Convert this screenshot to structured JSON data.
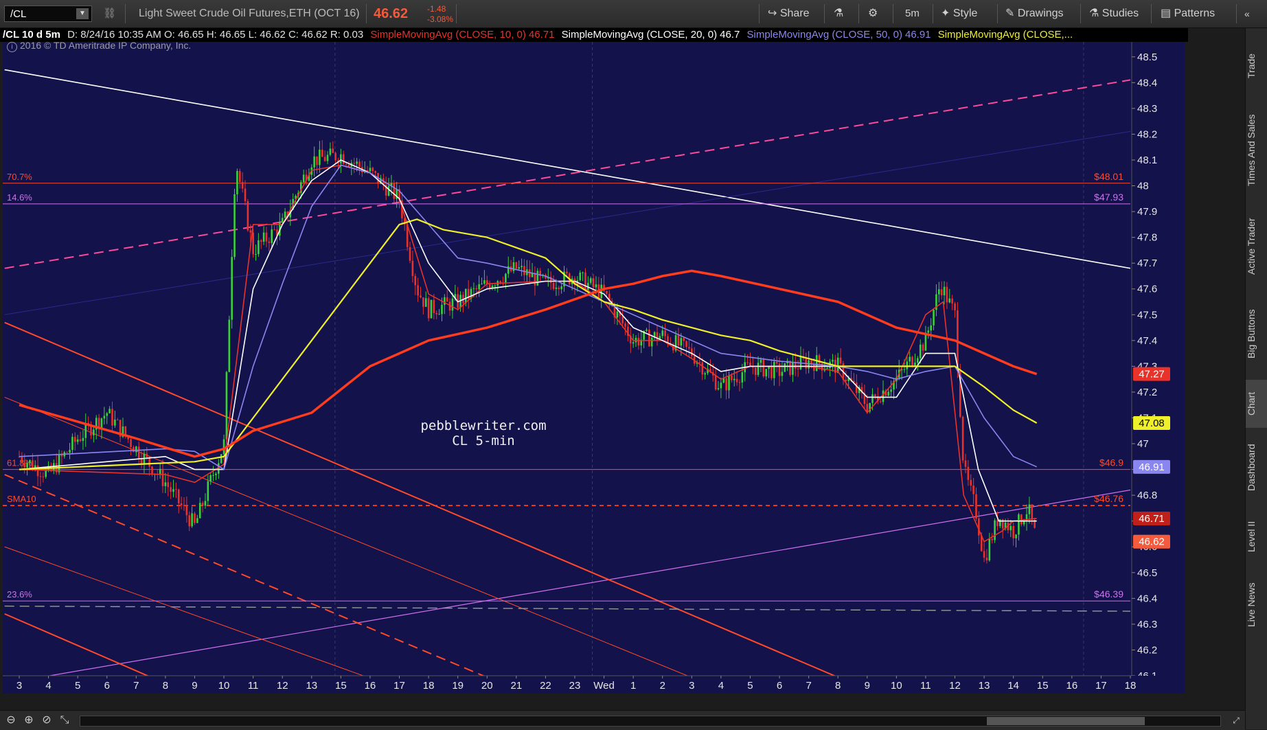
{
  "toolbar": {
    "symbol": "/CL",
    "instrument": "Light Sweet Crude Oil Futures,ETH (OCT 16)",
    "last_price": "46.62",
    "change": "-1.48",
    "change_pct": "-3.08%",
    "share": "Share",
    "timeframe": "5m",
    "style": "Style",
    "drawings": "Drawings",
    "studies": "Studies",
    "patterns": "Patterns"
  },
  "infobar": {
    "desc": "/CL 10 d 5m",
    "ohlc": "D: 8/24/16 10:35 AM  O: 46.65  H: 46.65  L: 46.62  C: 46.62  R: 0.03",
    "sma10": "SimpleMovingAvg (CLOSE, 10, 0)",
    "sma10_val": "46.71",
    "sma20": "SimpleMovingAvg (CLOSE, 20, 0)",
    "sma20_val": "46.7",
    "sma50": "SimpleMovingAvg (CLOSE, 50, 0)",
    "sma50_val": "46.91",
    "sma100": "SimpleMovingAvg (CLOSE,..."
  },
  "copyright": "2016 © TD Ameritrade IP Company, Inc.",
  "watermark": {
    "line1": "pebblewriter.com",
    "line2": "CL 5-min"
  },
  "side_tabs": [
    "Trade",
    "Times And Sales",
    "Active Trader",
    "Big Buttons",
    "Chart",
    "Dashboard",
    "Level II",
    "Live News"
  ],
  "colors": {
    "background": "#14124a",
    "sma10": "#e8322a",
    "sma20": "#ffffff",
    "sma50": "#8a86f0",
    "sma100": "#f0f02a",
    "sma200": "#ff3c1e",
    "fib_orange": "#ff4a2a",
    "fib_violet": "#d070f0"
  },
  "chart_data": {
    "type": "candlestick",
    "ylim": [
      46.1,
      48.55
    ],
    "y_ticks": [
      "48.5",
      "48.4",
      "48.3",
      "48.2",
      "48.1",
      "48",
      "47.9",
      "47.8",
      "47.7",
      "47.6",
      "47.5",
      "47.4",
      "47.3",
      "47.2",
      "47.1",
      "47",
      "46.9",
      "46.8",
      "46.7",
      "46.6",
      "46.5",
      "46.4",
      "46.3",
      "46.2",
      "46.1"
    ],
    "x_ticks": [
      "3",
      "4",
      "5",
      "6",
      "7",
      "8",
      "9",
      "10",
      "11",
      "12",
      "13",
      "15",
      "16",
      "17",
      "18",
      "19",
      "20",
      "21",
      "22",
      "23",
      "Wed",
      "1",
      "2",
      "3",
      "4",
      "5",
      "6",
      "7",
      "8",
      "9",
      "10",
      "11",
      "12",
      "13",
      "14",
      "15",
      "16",
      "17",
      "18"
    ],
    "fib_levels": [
      {
        "label": "70.7%",
        "value": 48.01,
        "value_label": "$48.01",
        "color": "#ff4a2a"
      },
      {
        "label": "14.6%",
        "value": 47.93,
        "value_label": "$47.93",
        "color": "#d070f0"
      },
      {
        "label": "61.8%",
        "value": 46.9,
        "value_label": "$46.9",
        "color": "#ff4a2a"
      },
      {
        "label": "SMA10",
        "value": 46.76,
        "value_label": "$46.76",
        "color": "#ff4a2a",
        "dashed": true
      },
      {
        "label": "23.6%",
        "value": 46.39,
        "value_label": "$46.39",
        "color": "#d070f0"
      }
    ],
    "price_badges": [
      {
        "value": 47.27,
        "label": "47.27",
        "color": "#e8322a"
      },
      {
        "value": 47.08,
        "label": "47.08",
        "color": "#f0f02a"
      },
      {
        "value": 46.91,
        "label": "46.91",
        "color": "#8a86f0"
      },
      {
        "value": 46.71,
        "label": "46.71",
        "color": "#c0201a"
      },
      {
        "value": 46.62,
        "label": "46.62",
        "color": "#f45a3c"
      }
    ],
    "price_path": [
      [
        0,
        46.95
      ],
      [
        1,
        46.88
      ],
      [
        2,
        47.02
      ],
      [
        3,
        47.12
      ],
      [
        4,
        46.98
      ],
      [
        5,
        46.85
      ],
      [
        6,
        46.68
      ],
      [
        7,
        47.0
      ],
      [
        7.4,
        48.1
      ],
      [
        8,
        47.75
      ],
      [
        9,
        47.85
      ],
      [
        10,
        48.1
      ],
      [
        11,
        48.12
      ],
      [
        12,
        48.05
      ],
      [
        13,
        47.95
      ],
      [
        13.6,
        47.6
      ],
      [
        14,
        47.52
      ],
      [
        15,
        47.55
      ],
      [
        16,
        47.62
      ],
      [
        17,
        47.68
      ],
      [
        18,
        47.62
      ],
      [
        19,
        47.65
      ],
      [
        20,
        47.58
      ],
      [
        21,
        47.4
      ],
      [
        22,
        47.42
      ],
      [
        23,
        47.35
      ],
      [
        24,
        47.22
      ],
      [
        25,
        47.3
      ],
      [
        26,
        47.28
      ],
      [
        27,
        47.32
      ],
      [
        28,
        47.3
      ],
      [
        29,
        47.15
      ],
      [
        30,
        47.25
      ],
      [
        31,
        47.4
      ],
      [
        31.5,
        47.62
      ],
      [
        32,
        47.5
      ],
      [
        32.3,
        46.9
      ],
      [
        32.7,
        46.75
      ],
      [
        33,
        46.55
      ],
      [
        33.5,
        46.72
      ],
      [
        34,
        46.66
      ],
      [
        34.5,
        46.75
      ],
      [
        34.8,
        46.62
      ]
    ],
    "series": [
      {
        "name": "SMA10",
        "color": "#e8322a",
        "values": [
          [
            0,
            46.9
          ],
          [
            5,
            46.88
          ],
          [
            6,
            46.85
          ],
          [
            7,
            46.92
          ],
          [
            8,
            47.85
          ],
          [
            9,
            47.85
          ],
          [
            10,
            48.06
          ],
          [
            11,
            48.08
          ],
          [
            12,
            48.05
          ],
          [
            13,
            47.95
          ],
          [
            14,
            47.58
          ],
          [
            15,
            47.52
          ],
          [
            16,
            47.62
          ],
          [
            18,
            47.63
          ],
          [
            19,
            47.63
          ],
          [
            20,
            47.55
          ],
          [
            21,
            47.4
          ],
          [
            22,
            47.4
          ],
          [
            23,
            47.33
          ],
          [
            24,
            47.25
          ],
          [
            25,
            47.3
          ],
          [
            27,
            47.3
          ],
          [
            28,
            47.28
          ],
          [
            29,
            47.12
          ],
          [
            30,
            47.25
          ],
          [
            31,
            47.5
          ],
          [
            31.6,
            47.55
          ],
          [
            32.3,
            46.8
          ],
          [
            33,
            46.62
          ],
          [
            33.6,
            46.66
          ],
          [
            34,
            46.7
          ],
          [
            34.8,
            46.71
          ]
        ]
      },
      {
        "name": "SMA20",
        "color": "#ffffff",
        "values": [
          [
            0,
            46.9
          ],
          [
            5,
            46.95
          ],
          [
            6,
            46.9
          ],
          [
            7,
            46.9
          ],
          [
            8,
            47.6
          ],
          [
            9,
            47.85
          ],
          [
            10,
            48.02
          ],
          [
            11,
            48.1
          ],
          [
            12,
            48.05
          ],
          [
            13,
            47.95
          ],
          [
            14,
            47.7
          ],
          [
            15,
            47.55
          ],
          [
            16,
            47.6
          ],
          [
            18,
            47.63
          ],
          [
            19,
            47.63
          ],
          [
            20,
            47.58
          ],
          [
            21,
            47.45
          ],
          [
            22,
            47.4
          ],
          [
            23,
            47.35
          ],
          [
            24,
            47.28
          ],
          [
            25,
            47.3
          ],
          [
            27,
            47.3
          ],
          [
            28,
            47.3
          ],
          [
            29,
            47.18
          ],
          [
            30,
            47.18
          ],
          [
            31,
            47.35
          ],
          [
            32,
            47.35
          ],
          [
            32.8,
            46.9
          ],
          [
            33.5,
            46.7
          ],
          [
            34.3,
            46.7
          ],
          [
            34.8,
            46.7
          ]
        ]
      },
      {
        "name": "SMA50",
        "color": "#8a86f0",
        "values": [
          [
            0,
            46.95
          ],
          [
            5,
            46.98
          ],
          [
            6,
            46.97
          ],
          [
            7,
            46.9
          ],
          [
            8,
            47.3
          ],
          [
            9,
            47.62
          ],
          [
            10,
            47.92
          ],
          [
            11,
            48.08
          ],
          [
            12,
            48.05
          ],
          [
            13,
            47.98
          ],
          [
            14,
            47.85
          ],
          [
            15,
            47.72
          ],
          [
            16,
            47.7
          ],
          [
            18,
            47.65
          ],
          [
            19,
            47.6
          ],
          [
            20,
            47.55
          ],
          [
            21,
            47.5
          ],
          [
            22,
            47.45
          ],
          [
            23,
            47.4
          ],
          [
            24,
            47.35
          ],
          [
            26,
            47.32
          ],
          [
            28,
            47.3
          ],
          [
            29,
            47.28
          ],
          [
            30,
            47.25
          ],
          [
            31,
            47.28
          ],
          [
            32,
            47.3
          ],
          [
            33,
            47.1
          ],
          [
            34,
            46.95
          ],
          [
            34.8,
            46.91
          ]
        ]
      },
      {
        "name": "SMA100",
        "color": "#f0f02a",
        "values": [
          [
            0,
            46.9
          ],
          [
            4,
            46.92
          ],
          [
            6,
            46.93
          ],
          [
            7,
            46.95
          ],
          [
            8,
            47.1
          ],
          [
            10,
            47.4
          ],
          [
            12,
            47.7
          ],
          [
            13,
            47.85
          ],
          [
            13.6,
            47.87
          ],
          [
            14.5,
            47.83
          ],
          [
            16,
            47.8
          ],
          [
            18,
            47.72
          ],
          [
            19,
            47.62
          ],
          [
            20,
            47.55
          ],
          [
            21,
            47.52
          ],
          [
            22,
            47.48
          ],
          [
            23,
            47.45
          ],
          [
            24,
            47.42
          ],
          [
            25,
            47.4
          ],
          [
            26,
            47.36
          ],
          [
            28,
            47.3
          ],
          [
            30,
            47.3
          ],
          [
            31,
            47.3
          ],
          [
            32,
            47.3
          ],
          [
            33,
            47.22
          ],
          [
            34,
            47.13
          ],
          [
            34.8,
            47.08
          ]
        ]
      },
      {
        "name": "SMA200",
        "color": "#ff3c1e",
        "values": [
          [
            0,
            47.15
          ],
          [
            4,
            47.02
          ],
          [
            6,
            46.95
          ],
          [
            7,
            46.98
          ],
          [
            8,
            47.05
          ],
          [
            10,
            47.12
          ],
          [
            12,
            47.3
          ],
          [
            13,
            47.35
          ],
          [
            14,
            47.4
          ],
          [
            16,
            47.45
          ],
          [
            18,
            47.52
          ],
          [
            19,
            47.56
          ],
          [
            20,
            47.6
          ],
          [
            21,
            47.62
          ],
          [
            22,
            47.65
          ],
          [
            23,
            47.67
          ],
          [
            24,
            47.65
          ],
          [
            26,
            47.6
          ],
          [
            28,
            47.55
          ],
          [
            30,
            47.45
          ],
          [
            32,
            47.4
          ],
          [
            33,
            47.35
          ],
          [
            34,
            47.3
          ],
          [
            34.8,
            47.27
          ]
        ]
      }
    ],
    "trendlines": [
      {
        "color": "#ffffff",
        "from": [
          -0.5,
          48.45
        ],
        "to": [
          38.5,
          47.67
        ],
        "width": 1.6
      },
      {
        "color": "#ff4a9a",
        "from": [
          -0.5,
          47.68
        ],
        "to": [
          38.5,
          48.42
        ],
        "width": 2,
        "dash": true
      },
      {
        "color": "#2a2a90",
        "from": [
          -0.5,
          47.5
        ],
        "to": [
          38.5,
          48.22
        ],
        "width": 1
      },
      {
        "color": "#d070f0",
        "from": [
          -0.5,
          46.07
        ],
        "to": [
          38.5,
          46.83
        ],
        "width": 1.2
      },
      {
        "color": "#ff4a2a",
        "from": [
          -0.5,
          47.47
        ],
        "to": [
          28.5,
          46.07
        ],
        "width": 2
      },
      {
        "color": "#ff4a2a",
        "from": [
          -0.5,
          47.18
        ],
        "to": [
          23.5,
          46.07
        ],
        "width": 1
      },
      {
        "color": "#ff4a2a",
        "from": [
          -0.5,
          46.88
        ],
        "to": [
          16.5,
          46.07
        ],
        "width": 2,
        "dash": true
      },
      {
        "color": "#ff4a2a",
        "from": [
          -0.5,
          46.6
        ],
        "to": [
          12.5,
          46.07
        ],
        "width": 1
      },
      {
        "color": "#ff4a2a",
        "from": [
          -0.5,
          46.34
        ],
        "to": [
          5,
          46.07
        ],
        "width": 2
      },
      {
        "color": "#999999",
        "from": [
          -0.5,
          46.37
        ],
        "to": [
          38.5,
          46.35
        ],
        "width": 1.4,
        "dash": true
      }
    ]
  }
}
